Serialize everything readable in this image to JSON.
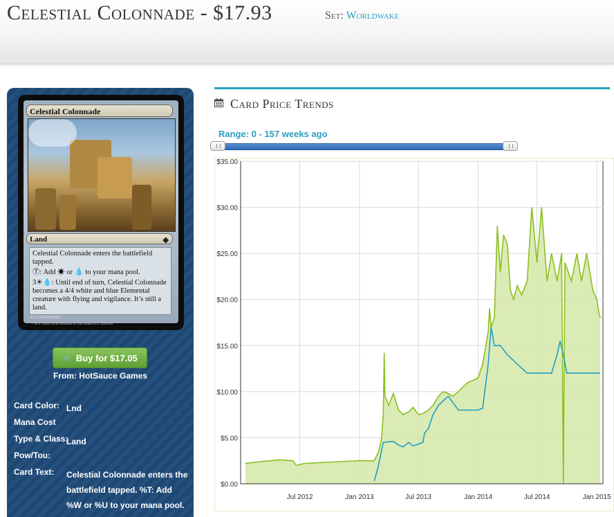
{
  "header": {
    "title": "Celestial Colonnade - $17.93",
    "set_label": "Set:",
    "set_name": "Worldwake"
  },
  "card_image": {
    "name": "Celestial Colonnade",
    "type": "Land",
    "rules_1": "Celestial Colonnade enters the battlefield tapped.",
    "rules_2": ": Add ☀ or 💧 to your mana pool.",
    "rules_3": "3☀💧: Until end of turn, Celestial Colonnade becomes a 4/4 white and blue Elemental creature with flying and vigilance. It’s still a land.",
    "artist": "Eric Deschamps",
    "copyright": "™ & © 1993–2010 Wizards of the Coast LLC 133/145"
  },
  "sidebar": {
    "buy_label": "Buy for $17.05",
    "from_label": "From: HotSauce Games",
    "fields": [
      {
        "key": "Card Color:",
        "value": "Lnd"
      },
      {
        "key": "Mana Cost",
        "value": ""
      },
      {
        "key": "Type & Class:",
        "value": "Land"
      },
      {
        "key": "Pow/Tou:",
        "value": ""
      },
      {
        "key": "Card Text:",
        "value": "Celestial Colonnade enters the battlefield tapped. %T: Add %W or %U to your mana pool."
      }
    ]
  },
  "trends": {
    "title": "Card Price Trends",
    "range_label": "Range: 0 - 157 weeks ago"
  },
  "colors": {
    "accent": "#1fa3c3",
    "green_line": "#8cbf1f",
    "green_fill": "#d5e8a8",
    "blue_line": "#1f9fc0"
  },
  "chart_data": {
    "type": "line",
    "title": "",
    "xlabel": "",
    "ylabel": "",
    "ylim": [
      0,
      35
    ],
    "yticks": [
      "$0.00",
      "$5.00",
      "$10.00",
      "$15.00",
      "$20.00",
      "$25.00",
      "$30.00",
      "$35.00"
    ],
    "xticks": [
      "Jul 2012",
      "Jan 2013",
      "Jul 2013",
      "Jan 2014",
      "Jul 2014",
      "Jan 2015"
    ],
    "grid": true,
    "series": [
      {
        "name": "",
        "color": "#8cbf1f",
        "filled": true,
        "points": [
          [
            "2012-01-15",
            2.2
          ],
          [
            "2012-03-01",
            2.4
          ],
          [
            "2012-05-01",
            2.6
          ],
          [
            "2012-06-10",
            2.5
          ],
          [
            "2012-06-20",
            2.0
          ],
          [
            "2012-07-15",
            2.2
          ],
          [
            "2012-09-01",
            2.3
          ],
          [
            "2012-11-01",
            2.4
          ],
          [
            "2013-01-01",
            2.5
          ],
          [
            "2013-02-15",
            2.5
          ],
          [
            "2013-03-01",
            3.5
          ],
          [
            "2013-03-10",
            5.0
          ],
          [
            "2013-03-15",
            7.5
          ],
          [
            "2013-03-18",
            14.2
          ],
          [
            "2013-03-20",
            9.5
          ],
          [
            "2013-04-01",
            8.5
          ],
          [
            "2013-04-15",
            9.8
          ],
          [
            "2013-05-01",
            8.0
          ],
          [
            "2013-05-15",
            7.5
          ],
          [
            "2013-06-01",
            7.8
          ],
          [
            "2013-06-15",
            8.3
          ],
          [
            "2013-07-01",
            7.5
          ],
          [
            "2013-07-15",
            7.6
          ],
          [
            "2013-08-01",
            8.0
          ],
          [
            "2013-08-15",
            8.5
          ],
          [
            "2013-09-01",
            9.5
          ],
          [
            "2013-09-15",
            10.0
          ],
          [
            "2013-10-01",
            9.8
          ],
          [
            "2013-10-15",
            9.5
          ],
          [
            "2013-11-01",
            10.0
          ],
          [
            "2013-11-15",
            10.5
          ],
          [
            "2013-12-01",
            11.0
          ],
          [
            "2013-12-15",
            11.2
          ],
          [
            "2014-01-01",
            11.5
          ],
          [
            "2014-01-15",
            13.0
          ],
          [
            "2014-02-01",
            16.5
          ],
          [
            "2014-02-05",
            19.0
          ],
          [
            "2014-02-10",
            17.0
          ],
          [
            "2014-02-20",
            18.0
          ],
          [
            "2014-03-01",
            28.0
          ],
          [
            "2014-03-10",
            23.0
          ],
          [
            "2014-03-20",
            27.0
          ],
          [
            "2014-04-01",
            26.0
          ],
          [
            "2014-04-10",
            21.0
          ],
          [
            "2014-04-20",
            20.0
          ],
          [
            "2014-05-01",
            21.5
          ],
          [
            "2014-05-15",
            20.5
          ],
          [
            "2014-06-01",
            22.0
          ],
          [
            "2014-06-15",
            30.0
          ],
          [
            "2014-07-01",
            24.0
          ],
          [
            "2014-07-15",
            30.0
          ],
          [
            "2014-08-01",
            22.0
          ],
          [
            "2014-08-15",
            25.0
          ],
          [
            "2014-09-01",
            22.0
          ],
          [
            "2014-09-15",
            25.0
          ],
          [
            "2014-09-20",
            0.0
          ],
          [
            "2014-09-25",
            24.0
          ],
          [
            "2014-10-15",
            22.0
          ],
          [
            "2014-11-01",
            25.0
          ],
          [
            "2014-11-15",
            22.0
          ],
          [
            "2014-12-01",
            25.0
          ],
          [
            "2014-12-20",
            21.0
          ],
          [
            "2015-01-01",
            20.0
          ],
          [
            "2015-01-08",
            18.5
          ],
          [
            "2015-01-12",
            18.0
          ]
        ]
      },
      {
        "name": "",
        "color": "#1f9fc0",
        "filled": false,
        "points": [
          [
            "2013-02-15",
            0.3
          ],
          [
            "2013-02-25",
            1.5
          ],
          [
            "2013-03-05",
            2.8
          ],
          [
            "2013-03-15",
            4.5
          ],
          [
            "2013-04-15",
            4.6
          ],
          [
            "2013-05-01",
            4.2
          ],
          [
            "2013-05-15",
            4.0
          ],
          [
            "2013-06-01",
            4.5
          ],
          [
            "2013-06-15",
            4.1
          ],
          [
            "2013-07-15",
            4.5
          ],
          [
            "2013-07-20",
            5.5
          ],
          [
            "2013-08-01",
            6.0
          ],
          [
            "2013-08-15",
            7.5
          ],
          [
            "2013-09-01",
            8.5
          ],
          [
            "2013-09-15",
            9.0
          ],
          [
            "2013-10-01",
            9.5
          ],
          [
            "2013-11-01",
            8.0
          ],
          [
            "2013-12-01",
            8.0
          ],
          [
            "2014-01-01",
            8.0
          ],
          [
            "2014-01-15",
            8.2
          ],
          [
            "2014-02-01",
            13.0
          ],
          [
            "2014-02-10",
            17.0
          ],
          [
            "2014-02-20",
            15.0
          ],
          [
            "2014-03-10",
            15.0
          ],
          [
            "2014-04-01",
            14.0
          ],
          [
            "2014-05-01",
            13.0
          ],
          [
            "2014-06-01",
            12.0
          ],
          [
            "2014-07-01",
            12.0
          ],
          [
            "2014-08-15",
            12.0
          ],
          [
            "2014-09-01",
            14.0
          ],
          [
            "2014-09-10",
            15.5
          ],
          [
            "2014-09-20",
            14.0
          ],
          [
            "2014-10-01",
            12.0
          ],
          [
            "2015-01-12",
            12.0
          ]
        ]
      }
    ]
  }
}
